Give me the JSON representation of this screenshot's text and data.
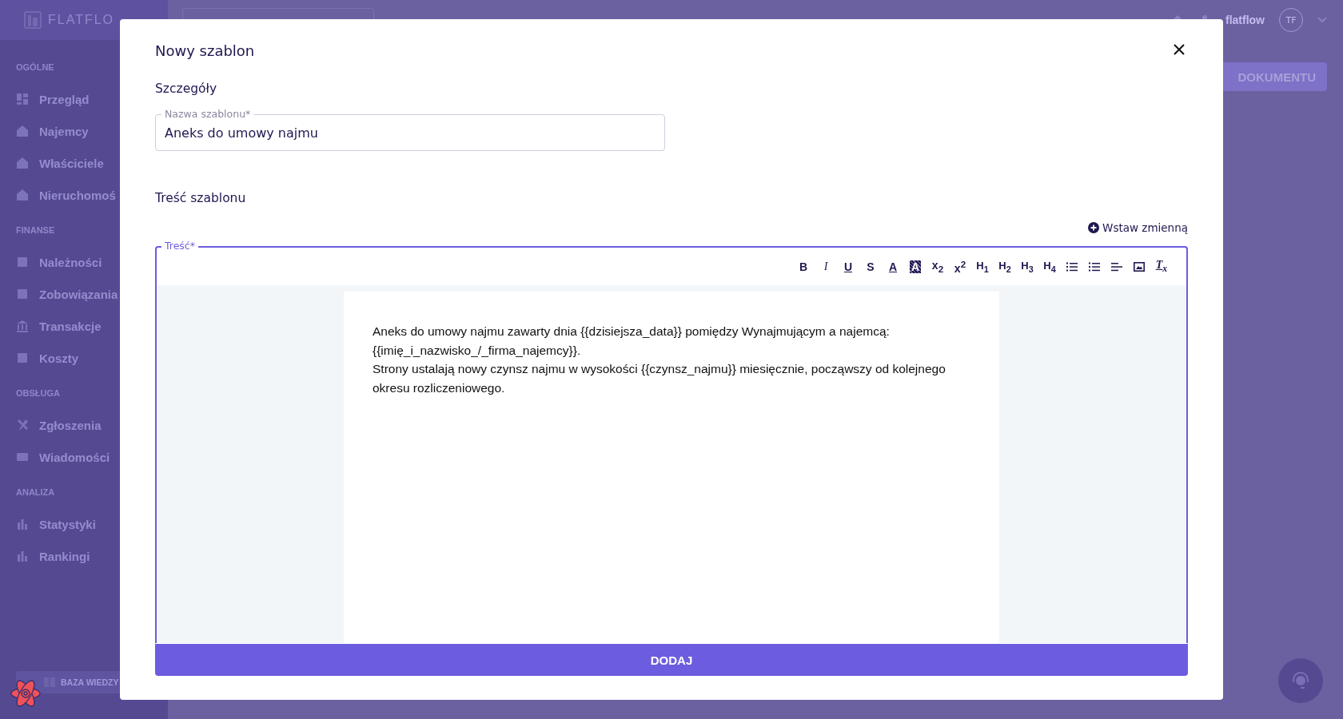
{
  "sidebar": {
    "logo": "FLATFLO",
    "sections": [
      {
        "title": "OGÓLNE",
        "items": [
          {
            "label": "Przegląd"
          },
          {
            "label": "Najemcy"
          },
          {
            "label": "Właściciele"
          },
          {
            "label": "Nieruchomoś"
          }
        ]
      },
      {
        "title": "FINANSE",
        "items": [
          {
            "label": "Należności"
          },
          {
            "label": "Zobowiązania"
          },
          {
            "label": "Transakcje"
          },
          {
            "label": "Koszty"
          }
        ]
      },
      {
        "title": "OBSŁUGA",
        "items": [
          {
            "label": "Zgłoszenia"
          },
          {
            "label": "Wiadomości"
          }
        ]
      },
      {
        "title": "ANALIZA",
        "items": [
          {
            "label": "Statystyki"
          },
          {
            "label": "Rankingi"
          }
        ]
      }
    ],
    "knowledge_button": "BAZA WIEDZY"
  },
  "topbar": {
    "user": "flatflow",
    "avatar": "TF",
    "action_button": "DOKUMENTU"
  },
  "modal": {
    "title": "Nowy szablon",
    "details_heading": "Szczegóły",
    "name_field": {
      "label": "Nazwa szablonu*",
      "value": "Aneks do umowy najmu"
    },
    "content_heading": "Treść szablonu",
    "insert_variable": "Wstaw zmienną",
    "editor": {
      "label": "Treść*",
      "focused": true,
      "toolbar": [
        {
          "kind": "bold",
          "label": "B"
        },
        {
          "kind": "italic",
          "label": "I"
        },
        {
          "kind": "underline",
          "label": "U"
        },
        {
          "kind": "strike",
          "label": "S"
        },
        {
          "kind": "color",
          "label": "A"
        },
        {
          "kind": "highlight",
          "label": "A"
        },
        {
          "kind": "script",
          "label": "x$_{2}$"
        },
        {
          "kind": "script",
          "label": "x$^{2}$"
        },
        {
          "kind": "heading",
          "label": "H$_{1}$"
        },
        {
          "kind": "heading",
          "label": "H$_{2}$"
        },
        {
          "kind": "heading",
          "label": "H$_{3}$"
        },
        {
          "kind": "heading",
          "label": "H$_{4}$"
        },
        {
          "kind": "ordered-list"
        },
        {
          "kind": "bullet-list"
        },
        {
          "kind": "align"
        },
        {
          "kind": "image"
        },
        {
          "kind": "clear",
          "label": "T$_{x}$"
        }
      ],
      "paragraphs": [
        "Aneks do umowy najmu zawarty dnia {{dzisiejsza_data}} pomiędzy Wynajmującym a najemcą: {{imię_i_nazwisko_/_firma_najemcy}}.",
        "Strony ustalają nowy czynsz najmu w wysokości {{czynsz_najmu}} miesięcznie, począwszy od kolejnego okresu rozliczeniowego."
      ]
    },
    "submit": "DODAJ"
  }
}
